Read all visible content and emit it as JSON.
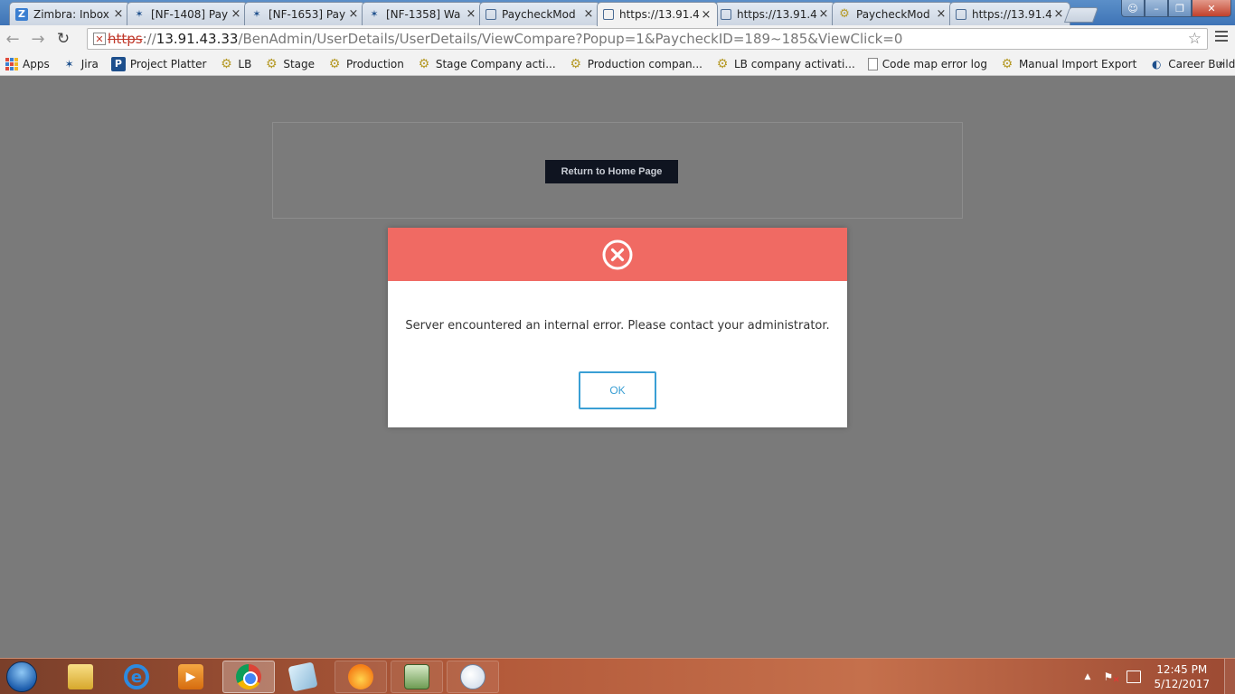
{
  "browser": {
    "tabs": [
      {
        "title": "Zimbra: Inbox",
        "icon": "zimbra-icon",
        "active": false
      },
      {
        "title": "[NF-1408] Pay",
        "icon": "jira-icon",
        "active": false
      },
      {
        "title": "[NF-1653] Pay",
        "icon": "jira-icon",
        "active": false
      },
      {
        "title": "[NF-1358] Wa",
        "icon": "jira-icon",
        "active": false
      },
      {
        "title": "PaycheckMod",
        "icon": "globe-icon",
        "active": false
      },
      {
        "title": "https://13.91.4",
        "icon": "globe-icon",
        "active": true
      },
      {
        "title": "https://13.91.4",
        "icon": "globe-icon",
        "active": false
      },
      {
        "title": "PaycheckMod",
        "icon": "gear-icon",
        "active": false
      },
      {
        "title": "https://13.91.4",
        "icon": "globe-icon",
        "active": false
      }
    ],
    "tab_close": "×",
    "url": {
      "scheme": "https",
      "sep": "://",
      "host": "13.91.43.33",
      "path": "/BenAdmin/UserDetails/UserDetails/ViewCompare?Popup=1&PaycheckID=189~185&ViewClick=0"
    },
    "bookmarks": [
      {
        "label": "Apps",
        "icon": "apps-grid-icon"
      },
      {
        "label": "Jira",
        "icon": "jira-icon"
      },
      {
        "label": "Project Platter",
        "icon": "p-icon"
      },
      {
        "label": "LB",
        "icon": "gear-icon"
      },
      {
        "label": "Stage",
        "icon": "gear-icon"
      },
      {
        "label": "Production",
        "icon": "gear-icon"
      },
      {
        "label": "Stage Company acti...",
        "icon": "gear-icon"
      },
      {
        "label": "Production compan...",
        "icon": "gear-icon"
      },
      {
        "label": "LB company activati...",
        "icon": "gear-icon"
      },
      {
        "label": "Code map error log",
        "icon": "page-icon"
      },
      {
        "label": "Manual Import Export",
        "icon": "gear-icon"
      },
      {
        "label": "Career Builder Login...",
        "icon": "cb-icon"
      }
    ],
    "bookmarks_more": "»"
  },
  "page": {
    "home_button": "Return to Home Page"
  },
  "modal": {
    "icon": "error-x-icon",
    "message": "Server encountered an internal error. Please contact your administrator.",
    "ok_label": "OK",
    "header_color": "#f06a63",
    "accent_color": "#3a9fd4"
  },
  "taskbar": {
    "time": "12:45 PM",
    "date": "5/12/2017",
    "apps": [
      "folder-icon",
      "ie-icon",
      "media-icon",
      "chrome-icon",
      "notes-icon",
      "firefox-icon",
      "calculator-icon",
      "paint-icon"
    ]
  }
}
